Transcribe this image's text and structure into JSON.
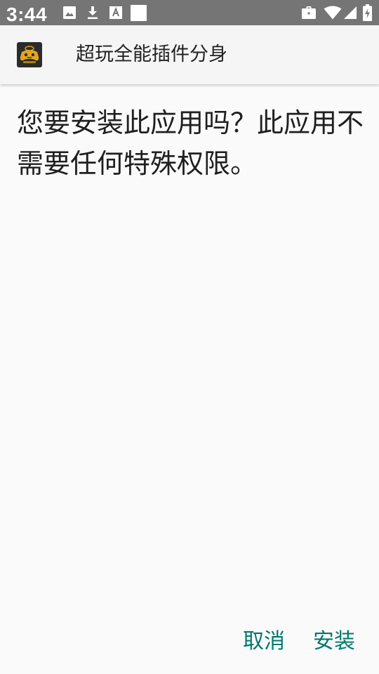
{
  "status_bar": {
    "time": "3:44",
    "notification_icons": [
      "image-icon",
      "download-icon",
      "text-a-icon",
      "blank-square-icon"
    ],
    "system_icons": [
      "briefcase-icon",
      "wifi-icon",
      "cell-signal-icon",
      "battery-charging-icon"
    ]
  },
  "app_bar": {
    "app_name": "超玩全能插件分身",
    "app_icon": "app-logo-icon"
  },
  "dialog": {
    "message": "您要安装此应用吗？此应用不需要任何特殊权限。",
    "cancel_label": "取消",
    "install_label": "安装"
  },
  "colors": {
    "status_bar": "#757575",
    "app_bar": "#f5f5f5",
    "background": "#fafafa",
    "accent": "#00796b",
    "text": "#1f1f1f"
  }
}
